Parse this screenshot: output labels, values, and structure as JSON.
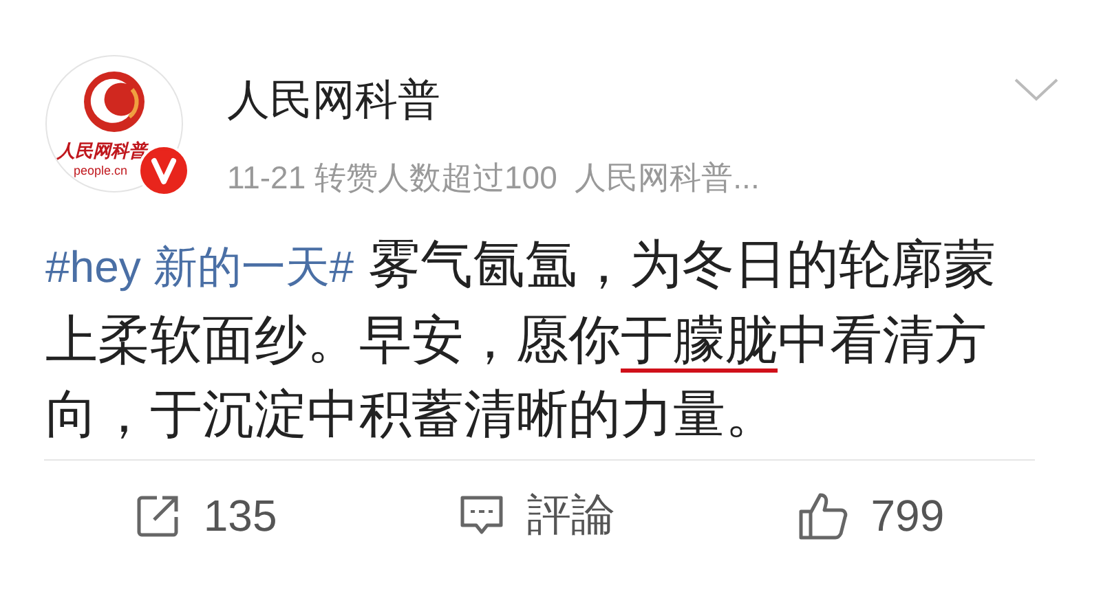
{
  "author": {
    "name": "人民网科普",
    "logo_text": "人民网科普",
    "logo_subtext": "people.cn",
    "verified": true
  },
  "meta": "11-21 转赞人数超过100  人民网科普...",
  "post": [
    {
      "kind": "hashtag",
      "text": "#hey 新的一天#"
    },
    {
      "kind": "plain",
      "text": " 雾气氤氲，为冬日的轮廓蒙上柔软面纱。早安，愿你"
    },
    {
      "kind": "underlined",
      "text": "于朦胧"
    },
    {
      "kind": "plain",
      "text": "中看清方向，于沉淀中积蓄清晰的力量。"
    }
  ],
  "actions": [
    {
      "kind": "repost",
      "label": "135"
    },
    {
      "kind": "comment",
      "label": "評論"
    },
    {
      "kind": "like",
      "label": "799"
    }
  ]
}
